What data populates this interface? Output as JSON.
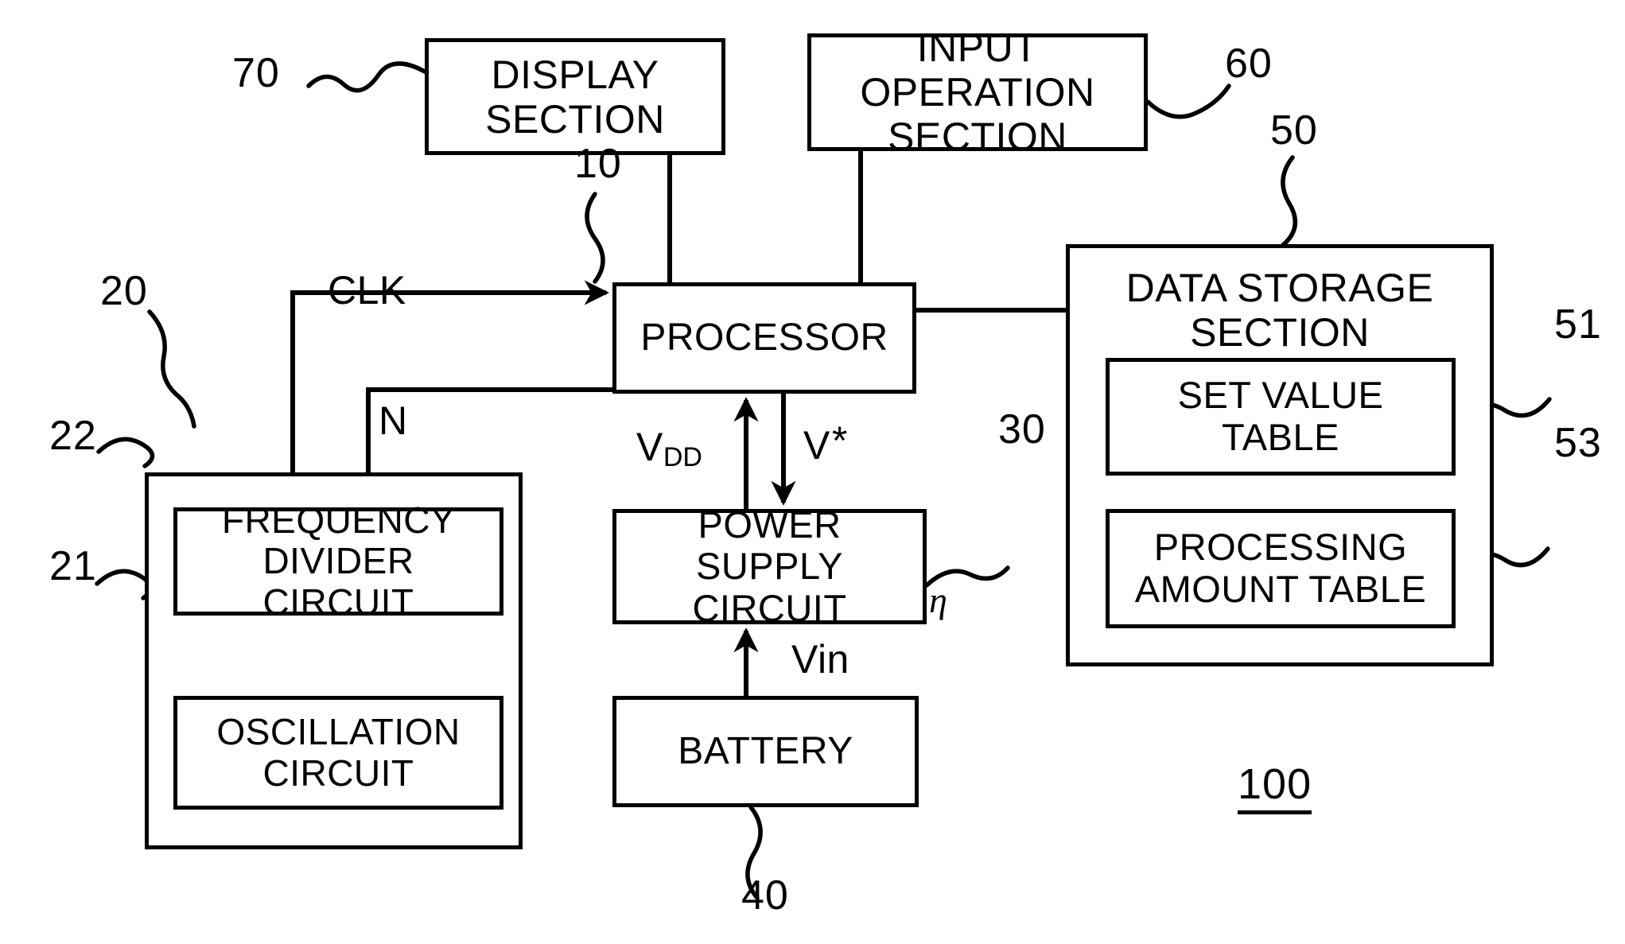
{
  "figure": {
    "system_number": "100",
    "blocks": {
      "display": {
        "label": "DISPLAY\nSECTION",
        "ref": "70"
      },
      "input_operation": {
        "label": "INPUT OPERATION\nSECTION",
        "ref": "60"
      },
      "processor": {
        "label": "PROCESSOR",
        "ref": "10"
      },
      "data_storage": {
        "label": "DATA STORAGE\nSECTION",
        "ref": "50"
      },
      "set_value_table": {
        "label": "SET VALUE TABLE",
        "ref": "51"
      },
      "processing_amount_table": {
        "label": "PROCESSING\nAMOUNT TABLE",
        "ref": "53"
      },
      "clock_unit": {
        "label": "",
        "ref": "20"
      },
      "frequency_divider": {
        "label": "FREQUENCY\nDIVIDER CIRCUIT",
        "ref": "22"
      },
      "oscillation": {
        "label": "OSCILLATION\nCIRCUIT",
        "ref": "21"
      },
      "power_supply": {
        "label": "POWER SUPPLY\nCIRCUIT",
        "ref": "30",
        "efficiency_symbol": "η"
      },
      "battery": {
        "label": "BATTERY",
        "ref": "40"
      }
    },
    "signals": {
      "clk": "CLK",
      "n": "N",
      "vdd_prefix": "V",
      "vdd_sub": "DD",
      "vstar_prefix": "V",
      "vstar_star": "*",
      "vin": "Vin"
    },
    "colors": {
      "ink": "#000000",
      "paper": "#ffffff"
    }
  }
}
